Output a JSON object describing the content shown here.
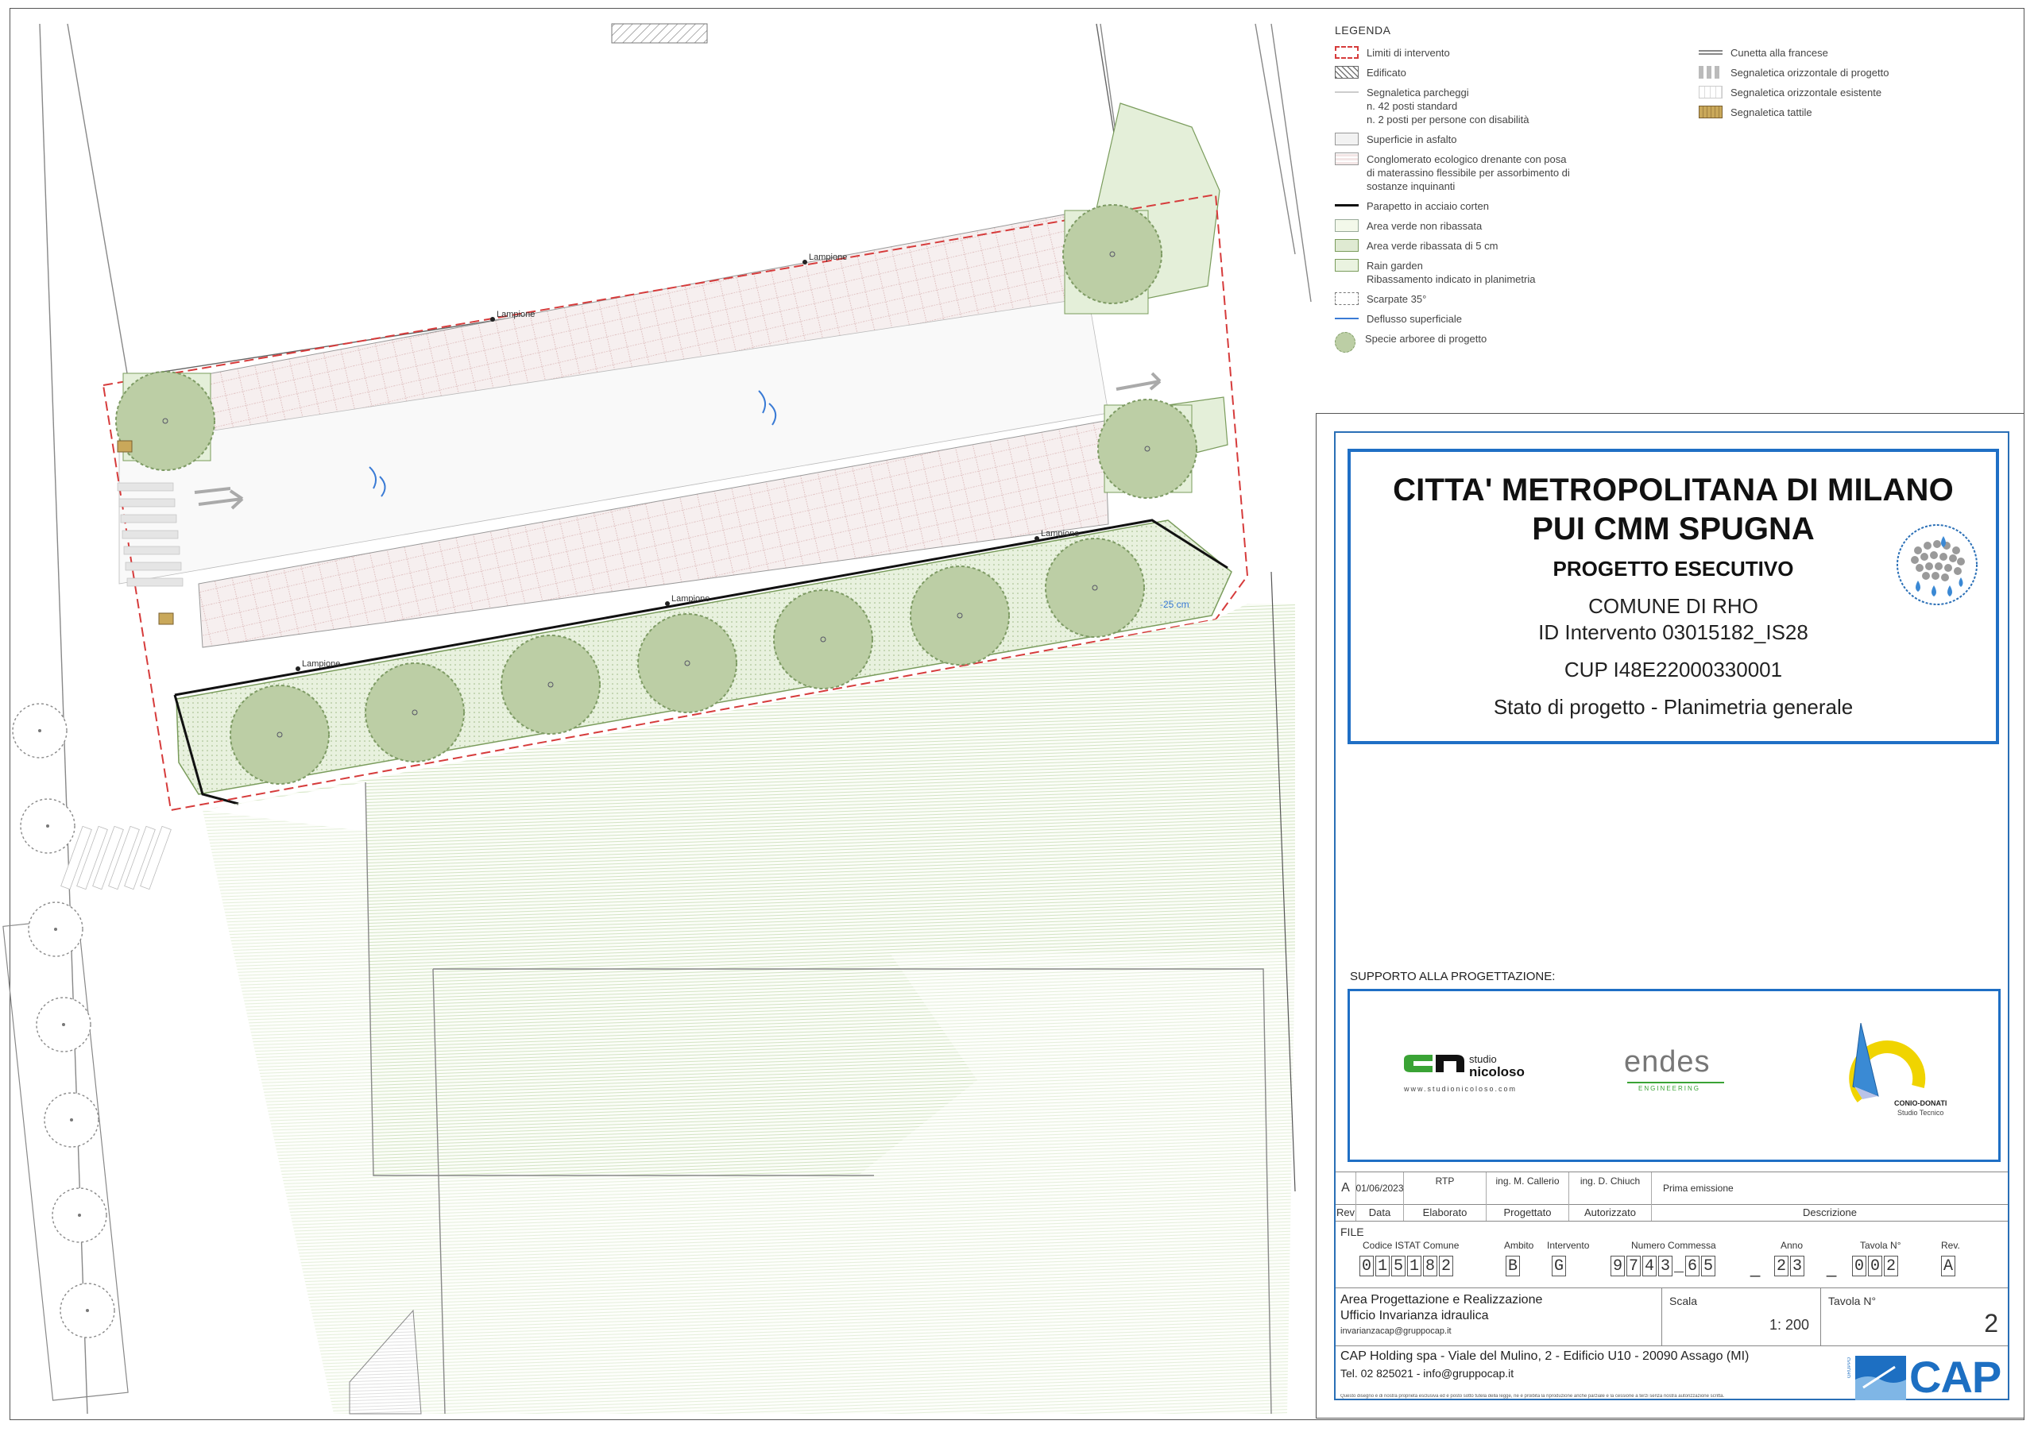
{
  "plan": {
    "labels": {
      "lampione": "Lampione",
      "depth": "-25 cm"
    }
  },
  "legend": {
    "title": "LEGENDA",
    "left": [
      {
        "icon": "red-dashed-box-icon",
        "lines": [
          "Limiti di intervento"
        ]
      },
      {
        "icon": "hatched-box-icon",
        "lines": [
          "Edificato"
        ]
      },
      {
        "icon": "thin-line-icon",
        "lines": [
          "Segnaletica parcheggi",
          "n. 42 posti standard",
          "n. 2 posti per persone con disabilità"
        ]
      },
      {
        "icon": "grey-box-icon",
        "lines": [
          "Superficie in asfalto"
        ]
      },
      {
        "icon": "red-dotted-box-icon",
        "lines": [
          "Conglomerato ecologico drenante con posa",
          "di materassino flessibile per assorbimento di",
          "sostanze inquinanti"
        ]
      },
      {
        "icon": "thick-line-icon",
        "lines": [
          "Parapetto in acciaio corten"
        ]
      },
      {
        "icon": "pale-green-box-icon",
        "lines": [
          "Area verde non ribassata"
        ]
      },
      {
        "icon": "green-box-icon",
        "lines": [
          "Area verde ribassata di 5 cm"
        ]
      },
      {
        "icon": "light-green-box-icon",
        "lines": [
          "Rain garden",
          "Ribassamento indicato in planimetria"
        ]
      },
      {
        "icon": "dashed-box-icon",
        "lines": [
          "Scarpate 35°"
        ]
      },
      {
        "icon": "blue-arrow-icon",
        "lines": [
          "Deflusso superficiale"
        ]
      },
      {
        "icon": "tree-icon",
        "lines": [
          "Specie arboree di progetto"
        ]
      }
    ],
    "right": [
      {
        "icon": "double-line-icon",
        "lines": [
          "Cunetta alla francese"
        ]
      },
      {
        "icon": "grey-stripes-icon",
        "lines": [
          "Segnaletica orizzontale di progetto"
        ]
      },
      {
        "icon": "white-stripes-icon",
        "lines": [
          "Segnaletica orizzontale esistente"
        ]
      },
      {
        "icon": "tactile-icon",
        "lines": [
          "Segnaletica tattile"
        ]
      }
    ]
  },
  "title_block": {
    "line1": "CITTA' METROPOLITANA DI MILANO",
    "line2": "PUI CMM SPUGNA",
    "line3": "PROGETTO ESECUTIVO",
    "line4": "COMUNE DI RHO",
    "line5": "ID Intervento 03015182_IS28",
    "line6": "CUP I48E22000330001",
    "line7": "Stato di progetto - Planimetria generale",
    "support_label": "SUPPORTO ALLA PROGETTAZIONE:",
    "logos": {
      "nicoloso_studio": "studio",
      "nicoloso_name": "nicoloso",
      "nicoloso_url": "www.studionicoloso.com",
      "endes": "endes",
      "endes_sub": "ENGINEERING",
      "conio": "CONIO-DONATI",
      "conio_sub": "Studio Tecnico"
    },
    "revision": {
      "rev": "A",
      "date": "01/06/2023",
      "elaborato": "RTP",
      "progettato": "ing. M. Callerio",
      "autorizzato": "ing. D. Chiuch",
      "descrizione": "Prima emissione"
    },
    "headers": [
      "Rev",
      "Data",
      "Elaborato",
      "Progettato",
      "Autorizzato",
      "Descrizione"
    ],
    "file_label": "FILE",
    "code_labels": [
      "Codice ISTAT Comune",
      "Ambito",
      "Intervento",
      "Numero Commessa",
      "Anno",
      "Tavola N°",
      "Rev."
    ],
    "codes": {
      "istat": "015182",
      "ambito": "B",
      "intervento": "G",
      "commessa": "9743_65",
      "anno": "23",
      "tavola": "002",
      "rev": "A"
    },
    "area_line1": "Area Progettazione e Realizzazione",
    "area_line2": "Ufficio Invarianza idraulica",
    "area_email": "invarianzacap@gruppocap.it",
    "scala_label": "Scala",
    "scala_value": "1: 200",
    "tavola_label": "Tavola N°",
    "tavola_value": "2",
    "company_line": "CAP Holding spa - Viale del Mulino, 2 - Edificio U10 - 20090 Assago (MI)",
    "company_contact": "Tel. 02 825021 - info@gruppocap.it",
    "disclaimer": "Questo disegno è di nostra proprietà esclusiva ed è posto sotto tutela della legge, ne è proibita la riproduzione anche parziale e la cessione a terzi senza nostra autorizzazione scritta.",
    "cap_logo": "CAP",
    "cap_group": "GRUPPO"
  },
  "colors": {
    "blue": "#1f6fc5",
    "red_limit": "#d63b3b",
    "green_area": "#e4efd9",
    "tree": "#b9cca3",
    "cap_blue": "#1d6fc2"
  }
}
